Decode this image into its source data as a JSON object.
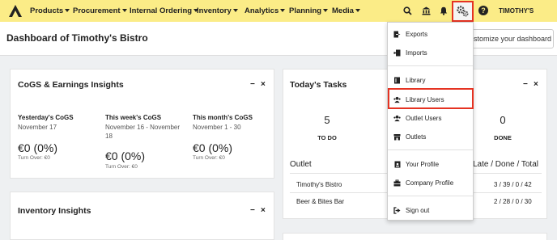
{
  "nav": {
    "items": [
      "Products",
      "Procurement",
      "Internal Ordering",
      "Inventory",
      "Analytics",
      "Planning",
      "Media"
    ],
    "user": "TIMOTHY'S BISTRO",
    "help": "?"
  },
  "header": {
    "title": "Dashboard of Timothy's Bistro",
    "customize_button": "stomize your dashboard"
  },
  "cogs": {
    "title": "CoGS & Earnings Insights",
    "minimize": "−",
    "close": "×",
    "columns": [
      {
        "title": "Yesterday's CoGS",
        "date": "November 17",
        "value": "€0 (0%)",
        "turnover": "Turn Over: €0"
      },
      {
        "title": "This week's CoGS",
        "date": "November 16 - November 18",
        "value": "€0 (0%)",
        "turnover": "Turn Over: €0"
      },
      {
        "title": "This month's CoGS",
        "date": "November 1 - 30",
        "value": "€0 (0%)",
        "turnover": "Turn Over: €0"
      }
    ]
  },
  "inventory": {
    "title": "Inventory Insights",
    "minimize": "−",
    "close": "×"
  },
  "tasks": {
    "title": "Today's Tasks",
    "minimize": "−",
    "close": "×",
    "todo_count": "5",
    "todo_label": "TO DO",
    "done_count": "0",
    "done_label": "DONE",
    "outlet_header": "Outlet",
    "stats_header": "Late / Done / Total",
    "rows": [
      {
        "outlet": "Timothy's Bistro",
        "stats": "3 / 39 / 0 / 42"
      },
      {
        "outlet": "Beer & Bites Bar",
        "stats": "2 / 28 / 0 / 30"
      }
    ]
  },
  "dropdown": {
    "items": [
      "Exports",
      "Imports",
      "Library",
      "Library Users",
      "Outlet Users",
      "Outlets",
      "Your Profile",
      "Company Profile",
      "Sign out"
    ]
  },
  "colors": {
    "nav_bg": "#fbec87",
    "highlight": "#e53322"
  }
}
